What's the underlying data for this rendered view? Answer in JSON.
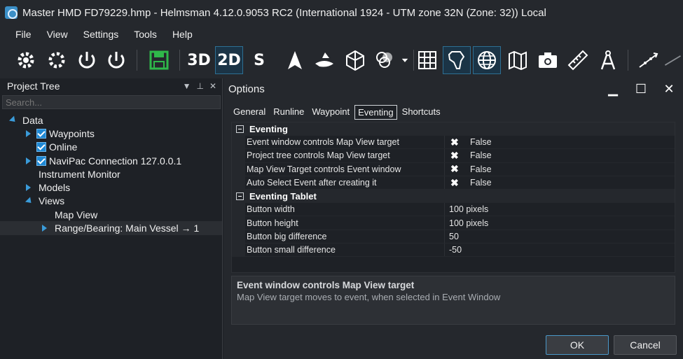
{
  "window": {
    "title": "Master HMD FD79229.hmp - Helmsman 4.12.0.9053 RC2 (International 1924 - UTM zone 32N (Zone: 32)) Local"
  },
  "menu": {
    "items": [
      "File",
      "View",
      "Settings",
      "Tools",
      "Help"
    ]
  },
  "toolbar": {
    "label_3d": "3D",
    "label_2d": "2D",
    "label_s": "S"
  },
  "project_tree": {
    "title": "Project Tree",
    "search_placeholder": "Search...",
    "items": [
      {
        "label": "Data"
      },
      {
        "label": "Waypoints"
      },
      {
        "label": "Online"
      },
      {
        "label": "NaviPac Connection 127.0.0.1"
      },
      {
        "label": "Instrument Monitor"
      },
      {
        "label": "Models"
      },
      {
        "label": "Views"
      },
      {
        "label": "Map View"
      },
      {
        "label": "Range/Bearing: Main Vessel → 1"
      }
    ]
  },
  "options": {
    "title": "Options",
    "tabs": [
      "General",
      "Runline",
      "Waypoint",
      "Eventing",
      "Shortcuts"
    ],
    "active_tab": "Eventing",
    "categories": [
      {
        "name": "Eventing",
        "props": [
          {
            "name": "Event window controls Map View target",
            "mark": "✖",
            "value": "False"
          },
          {
            "name": "Project tree controls Map View target",
            "mark": "✖",
            "value": "False"
          },
          {
            "name": "Map View Target controls Event window",
            "mark": "✖",
            "value": "False"
          },
          {
            "name": "Auto Select Event after creating it",
            "mark": "✖",
            "value": "False"
          }
        ]
      },
      {
        "name": "Eventing Tablet",
        "props": [
          {
            "name": "Button width",
            "value": "100 pixels"
          },
          {
            "name": "Button height",
            "value": "100 pixels"
          },
          {
            "name": "Button big difference",
            "value": "50"
          },
          {
            "name": "Button small difference",
            "value": "-50"
          }
        ]
      }
    ],
    "description": {
      "title": "Event window controls Map View target",
      "text": "Map View target moves to event, when selected in Event Window"
    },
    "ok_label": "OK",
    "cancel_label": "Cancel"
  },
  "colors": {
    "accent": "#3a9bd9",
    "panel_bg": "#1e2126",
    "chrome_bg": "#25282d"
  }
}
